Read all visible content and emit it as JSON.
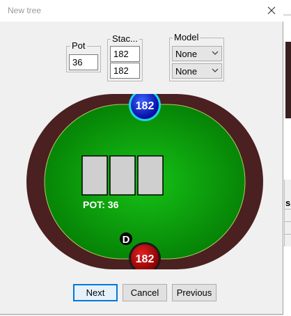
{
  "window": {
    "title": "New tree",
    "close_icon": "close-icon"
  },
  "pot_group": {
    "label": "Pot",
    "value": "36"
  },
  "stack_group": {
    "label": "Stac...",
    "values": [
      "182",
      "182"
    ]
  },
  "model_group": {
    "label": "Model",
    "options": [
      "None",
      "None"
    ]
  },
  "table": {
    "top_player_stack": "182",
    "bottom_player_stack": "182",
    "dealer_button": "D",
    "pot_label": "POT: 36",
    "board_cards": 3,
    "colors": {
      "felt": "#0fa80f",
      "rail": "#4a2020",
      "top_chip": "#0a18c8",
      "bottom_chip": "#b00000"
    }
  },
  "buttons": {
    "next": "Next",
    "cancel": "Cancel",
    "previous": "Previous"
  },
  "background": {
    "partial_text": "s"
  }
}
